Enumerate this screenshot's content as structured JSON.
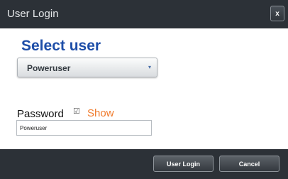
{
  "window": {
    "title": "User Login",
    "close_label": "x"
  },
  "main": {
    "heading": "Select user",
    "user_select": {
      "selected": "Poweruser",
      "caret": "▾"
    },
    "password": {
      "label": "Password",
      "checkbox": "☑",
      "show_label": "Show",
      "value": "Poweruser"
    }
  },
  "footer": {
    "login_label": "User Login",
    "cancel_label": "Cancel"
  },
  "colors": {
    "accent": "#1e4ea8",
    "show_link": "#f07b2c",
    "chrome": "#2c3137"
  }
}
